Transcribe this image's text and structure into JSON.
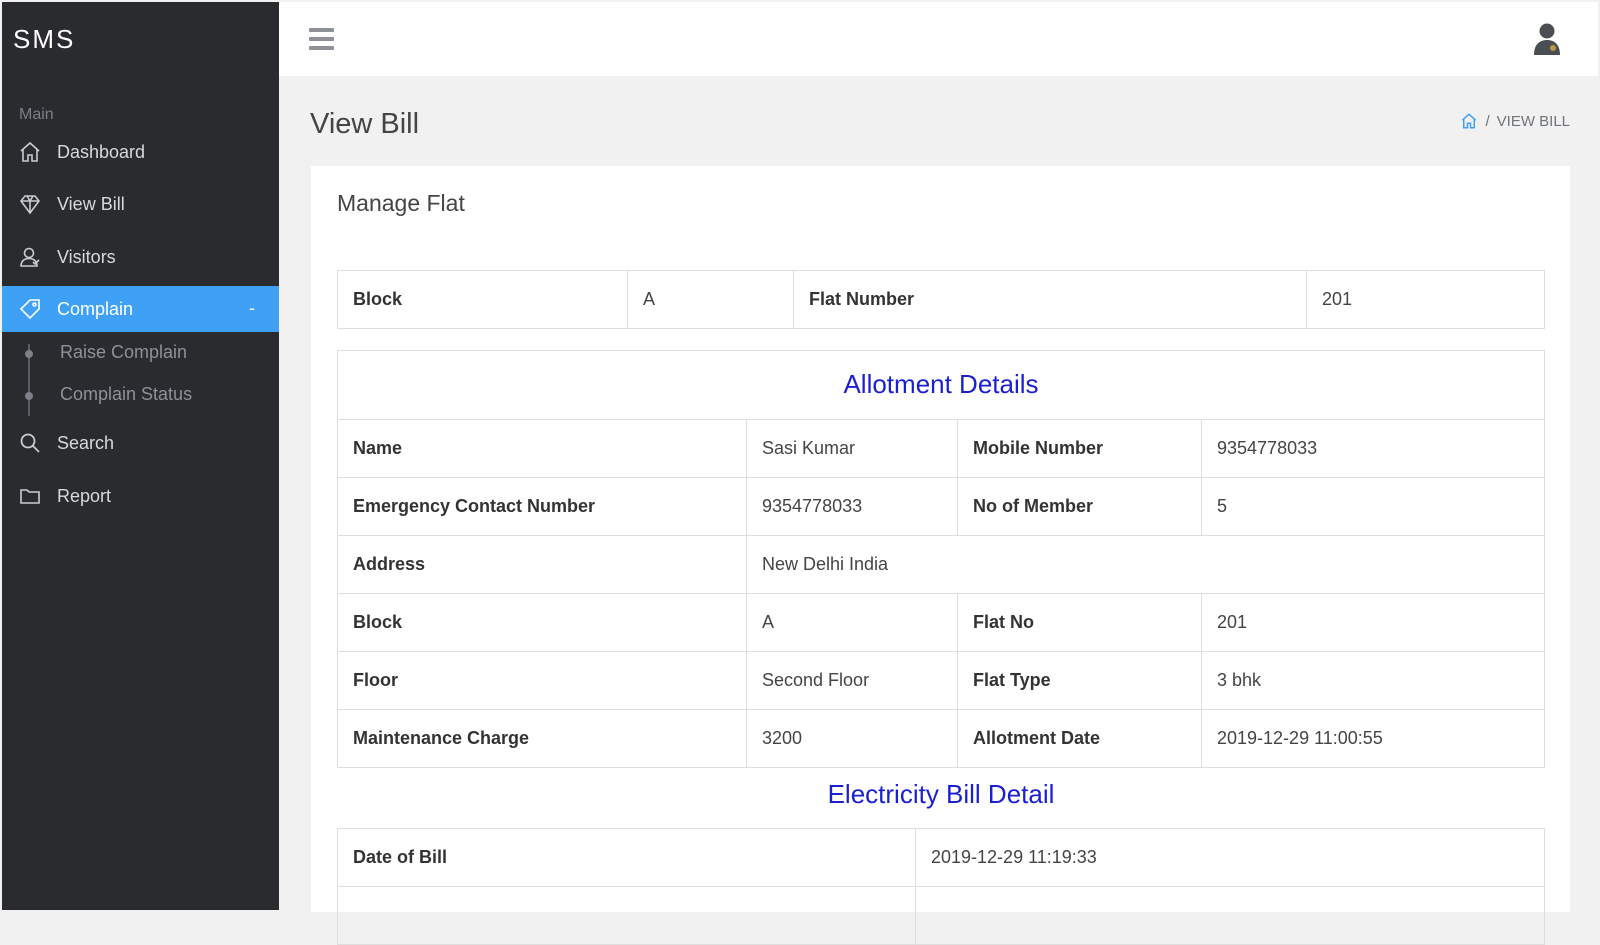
{
  "sidebar": {
    "brand": "SMS",
    "section_label": "Main",
    "items": [
      {
        "label": "Dashboard",
        "icon": "home-icon"
      },
      {
        "label": "View Bill",
        "icon": "diamond-icon"
      },
      {
        "label": "Visitors",
        "icon": "user-icon"
      },
      {
        "label": "Complain",
        "icon": "tag-icon",
        "toggle": "-"
      },
      {
        "label": "Search",
        "icon": "search-icon"
      },
      {
        "label": "Report",
        "icon": "folder-icon"
      }
    ],
    "subitems": [
      {
        "label": "Raise Complain"
      },
      {
        "label": "Complain Status"
      }
    ]
  },
  "page": {
    "title": "View Bill",
    "breadcrumb": "VIEW BILL"
  },
  "card": {
    "title": "Manage Flat",
    "flat_row": {
      "block_label": "Block",
      "block_value": "A",
      "flat_label": "Flat Number",
      "flat_value": "201"
    },
    "allotment": {
      "heading": "Allotment Details",
      "name_label": "Name",
      "name_value": "Sasi Kumar",
      "mobile_label": "Mobile Number",
      "mobile_value": "9354778033",
      "emergency_label": "Emergency Contact Number",
      "emergency_value": "9354778033",
      "members_label": "No of Member",
      "members_value": "5",
      "address_label": "Address",
      "address_value": "New Delhi India",
      "block_label": "Block",
      "block_value": "A",
      "flatno_label": "Flat No",
      "flatno_value": "201",
      "floor_label": "Floor",
      "floor_value": "Second Floor",
      "flattype_label": "Flat Type",
      "flattype_value": "3 bhk",
      "maint_label": "Maintenance Charge",
      "maint_value": "3200",
      "allotdate_label": "Allotment Date",
      "allotdate_value": "2019-12-29 11:00:55"
    },
    "electricity": {
      "heading": "Electricity Bill Detail",
      "date_label": "Date of Bill",
      "date_value": "2019-12-29 11:19:33"
    }
  },
  "colors": {
    "sidebar_bg": "#292b2f",
    "active": "#3ea1f6",
    "heading": "#1a1fcf",
    "date_red": "#d92222"
  }
}
